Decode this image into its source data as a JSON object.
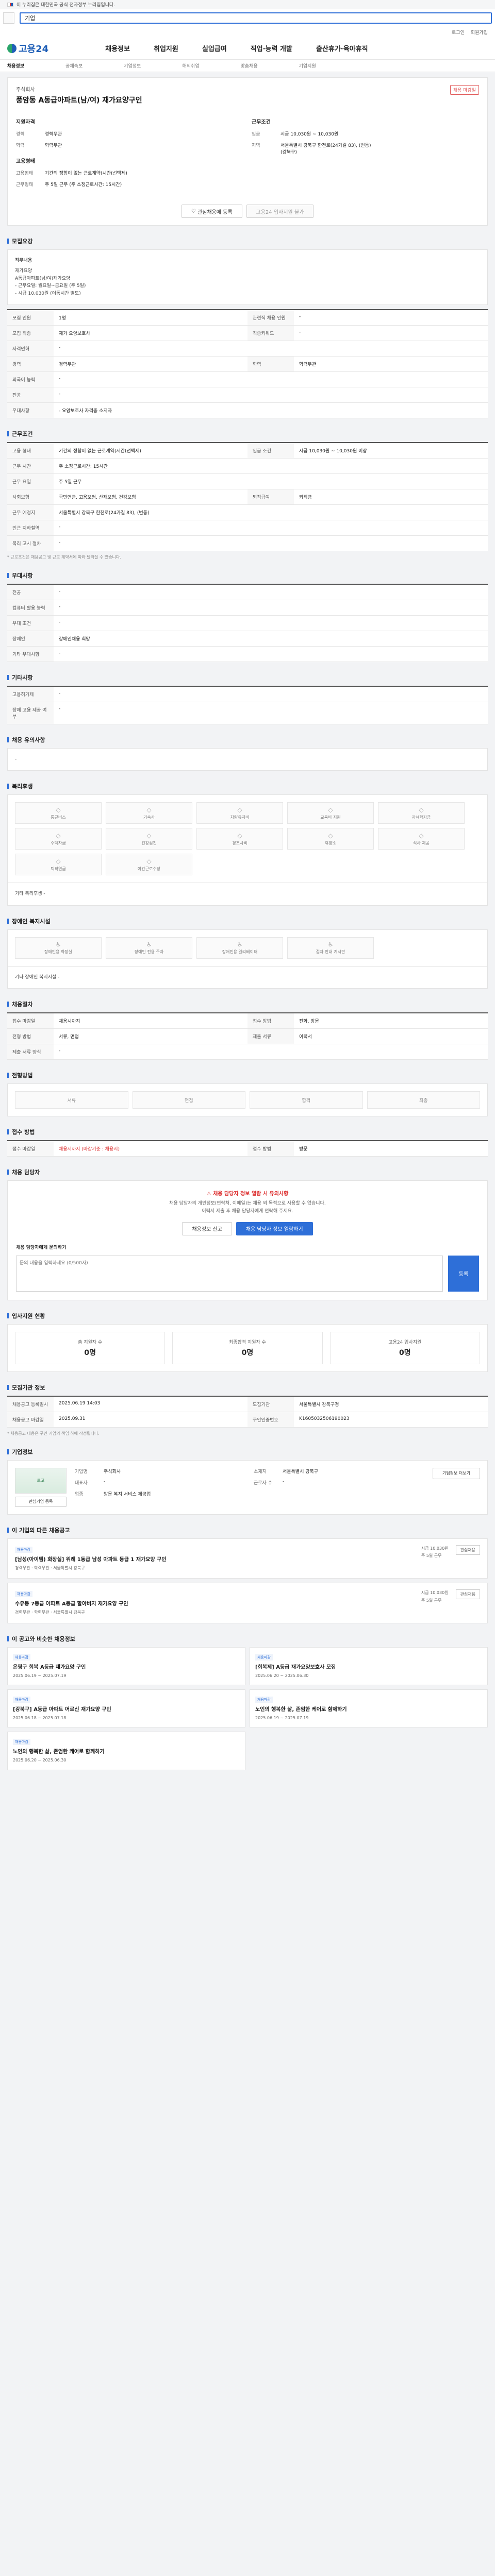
{
  "gov_banner": "이 누리집은 대한민국 공식 전자정부 누리집입니다.",
  "search": {
    "placeholder": "기업"
  },
  "util": [
    "로그인",
    "회원가입"
  ],
  "logo": "고용24",
  "gnb": [
    "채용정보",
    "취업지원",
    "실업급여",
    "직업·능력 개발",
    "출산휴가·육아휴직"
  ],
  "subnav": [
    "채용정보",
    "공채속보",
    "기업정보",
    "해외취업",
    "맞춤채용",
    "기업지원"
  ],
  "job": {
    "corp": "주식회사",
    "title": "풍암동 A동급아파트(남/여) 재가요양구인",
    "badge": "채용 마감일",
    "left_head": "지원자격",
    "left": [
      {
        "k": "경력",
        "v": "경력무관"
      },
      {
        "k": "학력",
        "v": "학력무관"
      }
    ],
    "right_head": "근무조건",
    "right": [
      {
        "k": "임금",
        "v": "시급 10,030원 ~ 10,030원"
      },
      {
        "k": "지역",
        "v": "서울특별시 강북구 한천로(24가길 83), (번동)",
        "v2": "(강북구)"
      }
    ],
    "mid_head": "고용형태",
    "mid": [
      {
        "k": "고용형태",
        "v": "기간의 정함이 없는 근로계약(시간(선택제)"
      },
      {
        "k": "근무형태",
        "v": "주 5일 근무 (주 소정근로시간: 15시간)"
      }
    ],
    "btn_like": "관심채용에 등록",
    "btn_apply": "고용24 입사지원 불가"
  },
  "recruit": {
    "title": "모집요강",
    "duty_label": "직무내용",
    "duty": [
      "재가요양",
      "A동급아파트(남/여)재가요양",
      "- 근무요일: 월요일~금요일 (주 5일)",
      "- 시급 10,030원 (이동시간 별도)"
    ],
    "rows": [
      {
        "k": "모집 인원",
        "v": "1명",
        "k2": "관련직 채용 인원",
        "v2": "-"
      },
      {
        "k": "모집 직종",
        "v": "재가 요양보호사",
        "k2": "직종키워드",
        "v2": "-"
      },
      {
        "k": "자격면허",
        "v": "-",
        "k2": "",
        "v2": ""
      },
      {
        "k": "경력",
        "v": "경력무관",
        "k2": "학력",
        "v2": "학력무관"
      },
      {
        "k": "외국어 능력",
        "v": "-",
        "k2": "",
        "v2": ""
      },
      {
        "k": "전공",
        "v": "-",
        "k2": "",
        "v2": ""
      },
      {
        "k": "우대사항",
        "v": "- 요양보호사 자격증 소지자",
        "k2": "",
        "v2": ""
      }
    ]
  },
  "conditions": {
    "title": "근무조건",
    "rows": [
      {
        "k": "고용 형태",
        "v": "기간의 정함이 없는 근로계약(시간(선택제)",
        "k2": "임금 조건",
        "v2": "시급 10,030원 ~ 10,030원 이상"
      },
      {
        "k": "근무 시간",
        "v": "주 소정근로시간: 15시간",
        "k2": "",
        "v2": ""
      },
      {
        "k": "근무 요일",
        "v": "주 5일 근무",
        "k2": "",
        "v2": ""
      },
      {
        "k": "사회보험",
        "v": "국민연금, 고용보험, 산재보험, 건강보험",
        "k2": "퇴직급여",
        "v2": "퇴직금"
      },
      {
        "k": "근무 예정지",
        "v": "서울특별시 강북구 한천로(24가길 83), (번동)",
        "k2": "",
        "v2": ""
      },
      {
        "k": "인근 지하철역",
        "v": "-",
        "k2": "",
        "v2": ""
      },
      {
        "k": "복리 고시 절차",
        "v": "-",
        "k2": "",
        "v2": ""
      }
    ],
    "note": "* 근로조건은 채용공고 및 근로 계약서에 따라 달라질 수 있습니다."
  },
  "prefer": {
    "title": "우대사항",
    "rows": [
      {
        "k": "전공",
        "v": "-"
      },
      {
        "k": "컴퓨터 활용 능력",
        "v": "-"
      },
      {
        "k": "우대 조건",
        "v": "-"
      },
      {
        "k": "장애인",
        "v": "장애인채용 희망"
      },
      {
        "k": "기타 우대사항",
        "v": "-"
      }
    ]
  },
  "other": {
    "title": "기타사항",
    "rows": [
      {
        "k": "고용허가제",
        "v": "-"
      },
      {
        "k": "장애 고용 제공 여부",
        "v": "-"
      }
    ]
  },
  "notice_title": "채용 유의사항",
  "notice": "-",
  "welfare": {
    "title": "복리후생",
    "items": [
      "통근버스",
      "기숙사",
      "차량유지비",
      "교육비 지원",
      "자녀학자금",
      "주택자금",
      "건강검진",
      "경조사비",
      "휴양소",
      "식사 제공",
      "퇴직연금",
      "야간근로수당"
    ],
    "extra_label": "기타 복리후생",
    "extra": "-"
  },
  "disability": {
    "title": "장애인 복지시설",
    "items": [
      "장애인용 화장실",
      "장애인 전용 주차",
      "장애인용 엘리베이터",
      "점자 안내 게시판"
    ],
    "extra_label": "기타 장애인 복지시설",
    "extra": "-"
  },
  "process": {
    "title": "채용절차",
    "rows": [
      {
        "k": "접수 마감일",
        "v": "채용시까지",
        "k2": "접수 방법",
        "v2": "전화, 방문"
      },
      {
        "k": "전형 방법",
        "v": "서류, 면접",
        "k2": "제출 서류",
        "v2": "이력서"
      },
      {
        "k": "제출 서류 양식",
        "v": "-",
        "k2": "",
        "v2": ""
      }
    ]
  },
  "steps": {
    "title": "전형방법",
    "items": [
      "서류",
      "면접",
      "합격",
      "최종"
    ]
  },
  "entry": {
    "title": "접수 방법",
    "label": "접수 마감일",
    "value": "채용시까지 (마감기준 : 채용시)",
    "label2": "접수 방법",
    "value2": "방문"
  },
  "apply": {
    "title": "채용 담당자",
    "alert": "채용 담당자 정보 열람 시 유의사항",
    "lines": [
      "채용 담당자의 개인정보(연락처, 이메일)는 채용 외 목적으로 사용할 수 없습니다.",
      "이력서 제출 후 채용 담당자에게 연락해 주세요."
    ],
    "btn_view": "채용 담당자 정보 열람하기",
    "btn_report": "채용정보 신고",
    "inquiry_label": "채용 담당자에게 문의하기",
    "inquiry_placeholder": "문의 내용을 입력하세요 (0/500자)",
    "inquiry_send": "등록"
  },
  "stats": {
    "title": "입사지원 현황",
    "items": [
      {
        "k": "총 지원자 수",
        "v": "0명"
      },
      {
        "k": "최종합격 지원자 수",
        "v": "0명"
      },
      {
        "k": "고용24 입사지원",
        "v": "0명"
      }
    ]
  },
  "info": {
    "title": "모집기관 정보",
    "rows": [
      {
        "k": "채용공고 등록일시",
        "v": "2025.06.19 14:03",
        "k2": "모집기관",
        "v2": "서울특별시 강북구청"
      },
      {
        "k": "채용공고 마감일",
        "v": "2025.09.31",
        "k2": "구인인증번호",
        "v2": "K1605032506190023"
      }
    ],
    "note": "* 채용공고 내용은 구인 기업의 책임 하에 작성됩니다."
  },
  "company": {
    "title": "기업정보",
    "name_k": "기업명",
    "name": "주식회사",
    "ceo_k": "대표자",
    "ceo": "-",
    "biz_k": "업종",
    "biz": "방문 복지 서비스 제공업",
    "addr_k": "소재지",
    "addr": "서울특별시 강북구",
    "emp_k": "근로자 수",
    "emp": "-",
    "logo_text": "로고",
    "btn_more": "기업정보 더보기",
    "btn_like": "관심기업 등록"
  },
  "same_company": {
    "title": "이 기업의 다른 채용공고",
    "items": [
      {
        "tag": "채용마감",
        "title": "[남성(아이템) 화장실] 위례 1동급 남성 아파트 등급 1 재가요양 구인",
        "meta": "경력무관 · 학력무관 · 서울특별시 강북구",
        "right": [
          "시급 10,030원",
          "주 5일 근무"
        ]
      },
      {
        "tag": "채용마감",
        "title": "수유동 7동급 아파트 A동급 할아버지 재가요양 구인",
        "meta": "경력무관 · 학력무관 · 서울특별시 강북구",
        "right": [
          "시급 10,030원",
          "주 5일 근무"
        ]
      }
    ],
    "btn": "관심채용"
  },
  "reco": {
    "title": "이 공고와 비슷한 채용정보",
    "items": [
      {
        "tag": "채용마감",
        "title": "은평구 희복 A등급 재가요양 구인",
        "meta": "2025.06.19 ~ 2025.07.19"
      },
      {
        "tag": "채용마감",
        "title": "[희복제] A등급 재가요양보호사 모집",
        "meta": "2025.06.20 ~ 2025.06.30"
      },
      {
        "tag": "채용마감",
        "title": "[강북구] A등급 아파트 어르신 재가요양 구인",
        "meta": "2025.06.18 ~ 2025.07.18"
      },
      {
        "tag": "채용마감",
        "title": "노인의 행복한 삶, 존엄한 케어로 함께하기",
        "meta": "2025.06.19 ~ 2025.07.19"
      },
      {
        "tag": "채용마감",
        "title": "노인의 행복한 삶, 존엄한 케어로 함께하기",
        "meta": "2025.06.20 ~ 2025.06.30"
      }
    ]
  }
}
